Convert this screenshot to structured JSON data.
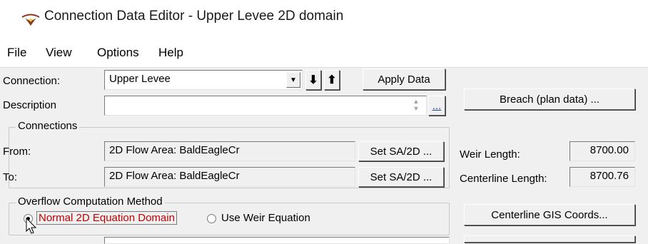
{
  "window": {
    "title": "Connection Data Editor - Upper Levee 2D domain",
    "icon": "river-app-icon"
  },
  "menu": [
    "File",
    "View",
    "Options",
    "Help"
  ],
  "connection": {
    "label": "Connection:",
    "value": "Upper Levee",
    "down_icon": "arrow-down-icon",
    "up_icon": "arrow-up-icon",
    "apply_label": "Apply Data"
  },
  "description": {
    "label": "Description",
    "value": "",
    "ellipsis": "..."
  },
  "breach_button": "Breach (plan data) ...",
  "connections_group": {
    "legend": "Connections",
    "from_label": "From:",
    "from_value": "2D Flow Area: BaldEagleCr",
    "to_label": "To:",
    "to_value": "2D Flow Area: BaldEagleCr",
    "set_label": "Set SA/2D ..."
  },
  "weir_length": {
    "label": "Weir Length:",
    "value": "8700.00"
  },
  "centerline_length": {
    "label": "Centerline Length:",
    "value": "8700.76"
  },
  "overflow": {
    "legend": "Overflow Computation Method",
    "option1": "Normal 2D Equation Domain",
    "option2": "Use Weir Equation",
    "selected": "Normal 2D Equation Domain",
    "option1_color": "#c00000"
  },
  "centerline_gis_button": "Centerline GIS Coords..."
}
